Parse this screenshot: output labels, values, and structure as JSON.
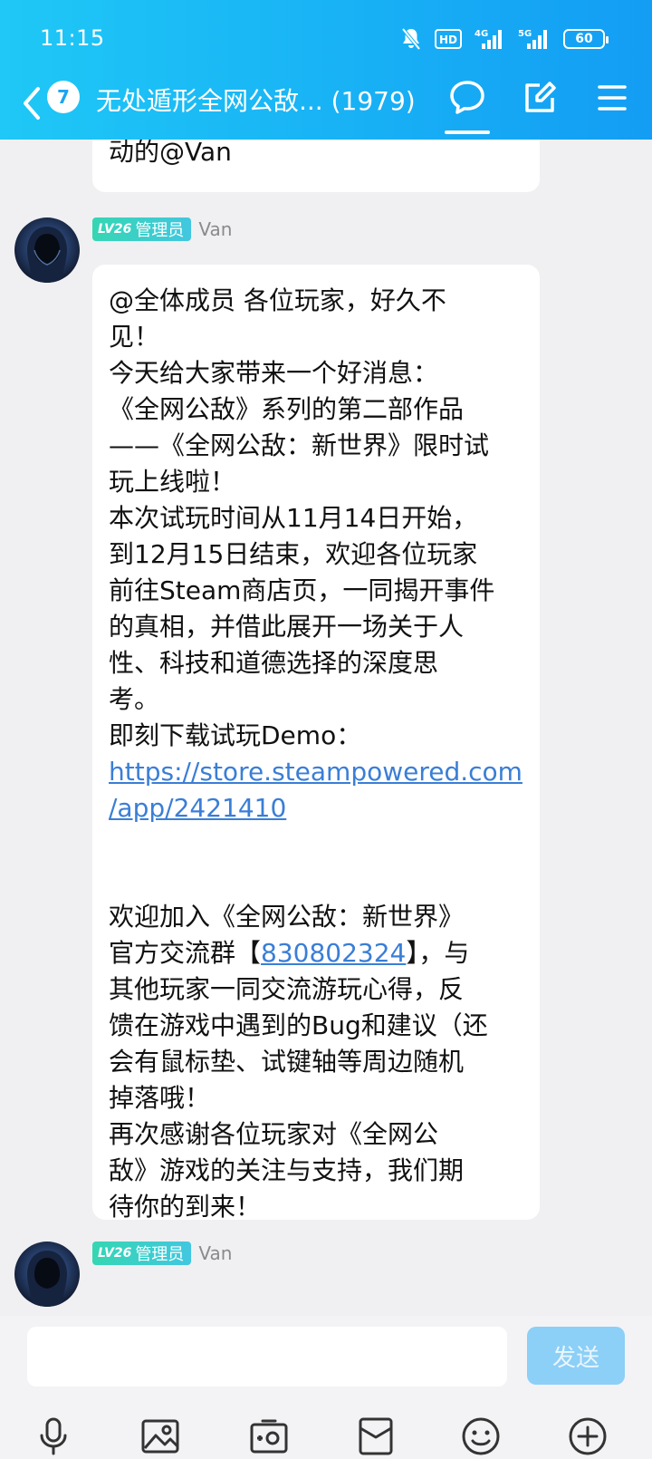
{
  "status_bar": {
    "time": "11:15",
    "hd_label": "HD",
    "network_4g": "4G",
    "network_5g": "5G",
    "battery": "60"
  },
  "nav": {
    "unread_count": "7",
    "title": "无处遁形全网公敌... (1979)"
  },
  "messages": {
    "prev_tail": "动的@Van",
    "main": {
      "level": "LV26",
      "role": "管理员",
      "sender": "Van",
      "lines": [
        "@全体成员 各位玩家，好久不",
        "见！",
        "今天给大家带来一个好消息：",
        "《全网公敌》系列的第二部作品",
        "——《全网公敌：新世界》限时试",
        "玩上线啦！",
        "本次试玩时间从11月14日开始，",
        "到12月15日结束，欢迎各位玩家",
        "前往Steam商店页，一同揭开事件",
        "的真相，并借此展开一场关于人",
        "性、科技和道德选择的深度思",
        "考。",
        "即刻下载试玩Demo："
      ],
      "link_line_1": "https://store.steampowered.com",
      "link_line_2": "/app/2421410",
      "join_line_1": "欢迎加入《全网公敌：新世界》",
      "join_prefix": "官方交流群【",
      "group_number": "830802324",
      "join_suffix": "】，与",
      "lines_after": [
        "其他玩家一同交流游玩心得，反",
        "馈在游戏中遇到的Bug和建议（还",
        "会有鼠标垫、试键轴等周边随机",
        "掉落哦！",
        "再次感谢各位玩家对《全网公",
        "敌》游戏的关注与支持，我们期",
        "待你的到来！"
      ]
    },
    "next": {
      "level": "LV26",
      "role": "管理员",
      "sender": "Van"
    }
  },
  "composer": {
    "input_value": "",
    "send_label": "发送"
  },
  "toolbar": {
    "icons": [
      "microphone-icon",
      "image-icon",
      "camera-icon",
      "red-packet-icon",
      "emoji-icon",
      "plus-icon"
    ]
  }
}
